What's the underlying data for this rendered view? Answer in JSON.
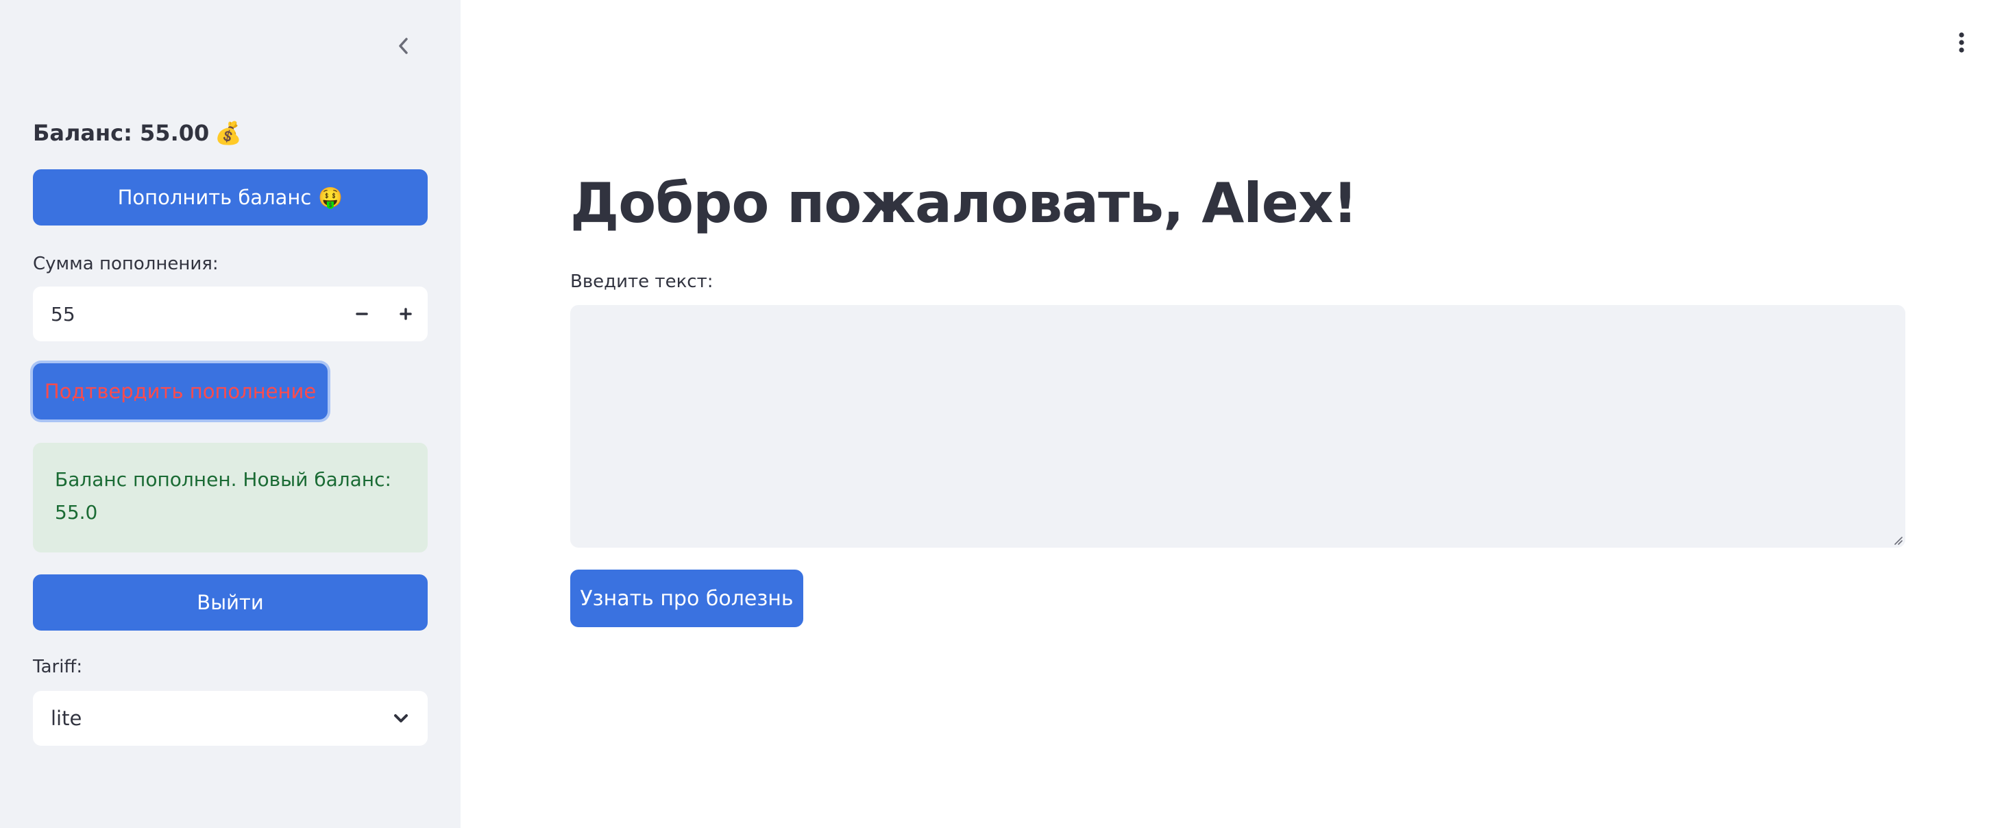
{
  "sidebar": {
    "collapse_icon": "chevron-left-icon",
    "balance_text": "Баланс: 55.00",
    "balance_emoji": "💰",
    "topup_button_label": "Пополнить баланс",
    "topup_button_emoji": "🤑",
    "amount_label": "Сумма пополнения:",
    "amount_value": "55",
    "confirm_button_label": "Подтвердить пополнение",
    "success_message": "Баланс пополнен. Новый баланс: 55.0",
    "logout_button_label": "Выйти",
    "tariff_label": "Tariff:",
    "tariff_value": "lite"
  },
  "main": {
    "menu_icon": "vertical-ellipsis-icon",
    "title": "Добро пожаловать, Alex!",
    "text_label": "Введите текст:",
    "text_value": "",
    "submit_button_label": "Узнать про болезнь"
  },
  "colors": {
    "primary": "#3a72e0",
    "sidebar_bg": "#f0f2f6",
    "text": "#31333f",
    "success_bg": "#e0ede3",
    "success_text": "#1a6b34",
    "danger_text": "#ff4b4b"
  }
}
